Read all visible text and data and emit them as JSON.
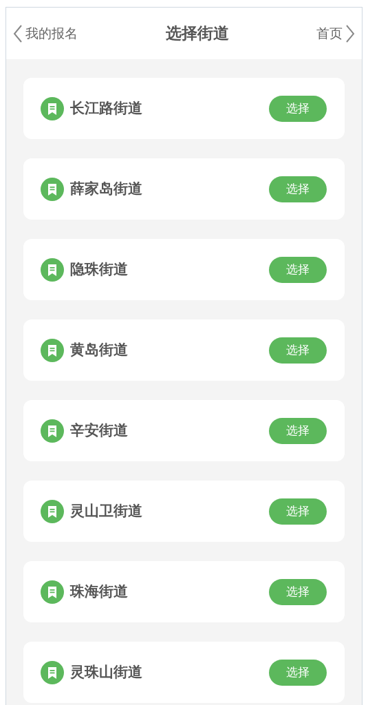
{
  "header": {
    "back_label": "我的报名",
    "title": "选择街道",
    "home_label": "首页"
  },
  "streets": [
    {
      "name": "长江路街道",
      "button": "选择"
    },
    {
      "name": "薛家岛街道",
      "button": "选择"
    },
    {
      "name": "隐珠街道",
      "button": "选择"
    },
    {
      "name": "黄岛街道",
      "button": "选择"
    },
    {
      "name": "辛安街道",
      "button": "选择"
    },
    {
      "name": "灵山卫街道",
      "button": "选择"
    },
    {
      "name": "珠海街道",
      "button": "选择"
    },
    {
      "name": "灵珠山街道",
      "button": "选择"
    }
  ]
}
